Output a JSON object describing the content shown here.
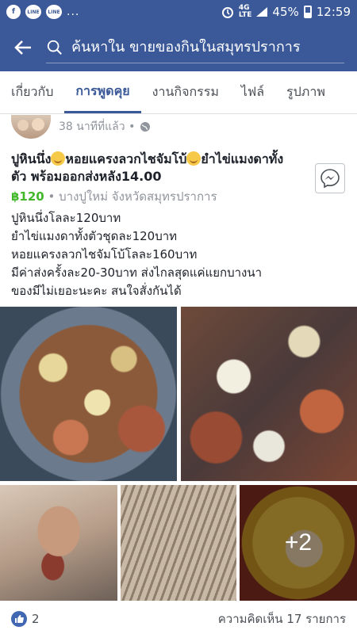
{
  "status_bar": {
    "app_labels": [
      "LINE",
      "LINE"
    ],
    "dots": "...",
    "network": [
      "4G",
      "LTE"
    ],
    "battery": "45%",
    "time": "12:59"
  },
  "search": {
    "placeholder": "ค้นหาใน ขายของกินในสมุทรปราการ"
  },
  "tabs": [
    {
      "label": "เกี่ยวกับ",
      "active": false
    },
    {
      "label": "การพูดคุย",
      "active": true
    },
    {
      "label": "งานกิจกรรม",
      "active": false
    },
    {
      "label": "ไฟล์",
      "active": false
    },
    {
      "label": "รูปภาพ",
      "active": false
    }
  ],
  "post": {
    "time": "38 นาทีที่แล้ว",
    "separator": "•",
    "title_part1": "ปูหินนึ่ง",
    "title_part2": "หอยแครงลวกไชจัมโบ้",
    "title_part3": "ยำไข่แมงดาทั้งตัว  พร้อมออกส่งหลัง14.00",
    "price": "฿120",
    "location": " • บางปูใหม่ จังหวัดสมุทรปราการ",
    "body": [
      "ปูหินนึ่งโลละ120บาท",
      "ยำไข่แมงดาทั้งตัวชุดละ120บาท",
      "หอยแครงลวกไชจัมโบ้โลละ160บาท",
      "มีค่าส่งครั้งละ20-30บาท  ส่งไกลสุดแค่แยกบางนา",
      "ของมีไม่เยอะนะคะ สนใจสั่งกันได้"
    ],
    "more_photos": "+2",
    "likes": "2",
    "comments": "ความคิดเห็น 17 รายการ"
  },
  "colors": {
    "header": "#3b5998",
    "price": "#42b72a",
    "like": "#4267b2"
  }
}
